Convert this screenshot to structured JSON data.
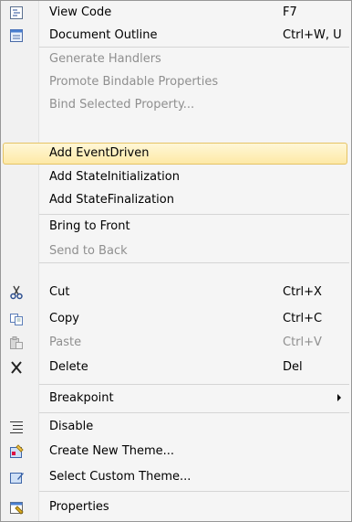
{
  "menu": {
    "items": [
      {
        "label": "View Code",
        "shortcut": "F7",
        "icon": "view-code-icon"
      },
      {
        "label": "Document Outline",
        "shortcut": "Ctrl+W, U",
        "icon": "document-outline-icon"
      },
      {
        "label": "Generate Handlers",
        "disabled": true
      },
      {
        "label": "Promote Bindable Properties",
        "disabled": true
      },
      {
        "label": "Bind Selected Property...",
        "disabled": true
      },
      {
        "label": "Add EventDriven",
        "highlighted": true
      },
      {
        "label": "Add StateInitialization"
      },
      {
        "label": "Add StateFinalization"
      },
      {
        "label": "Bring to Front"
      },
      {
        "label": "Send to Back",
        "disabled": true
      },
      {
        "label": "Cut",
        "shortcut": "Ctrl+X",
        "icon": "cut-icon"
      },
      {
        "label": "Copy",
        "shortcut": "Ctrl+C",
        "icon": "copy-icon"
      },
      {
        "label": "Paste",
        "shortcut": "Ctrl+V",
        "icon": "paste-icon",
        "disabled": true
      },
      {
        "label": "Delete",
        "shortcut": "Del",
        "icon": "delete-icon"
      },
      {
        "label": "Breakpoint",
        "submenu": true
      },
      {
        "label": "Disable",
        "icon": "disable-icon"
      },
      {
        "label": "Create New Theme...",
        "icon": "create-theme-icon"
      },
      {
        "label": "Select Custom Theme...",
        "icon": "select-theme-icon"
      },
      {
        "label": "Properties",
        "icon": "properties-icon"
      }
    ]
  }
}
